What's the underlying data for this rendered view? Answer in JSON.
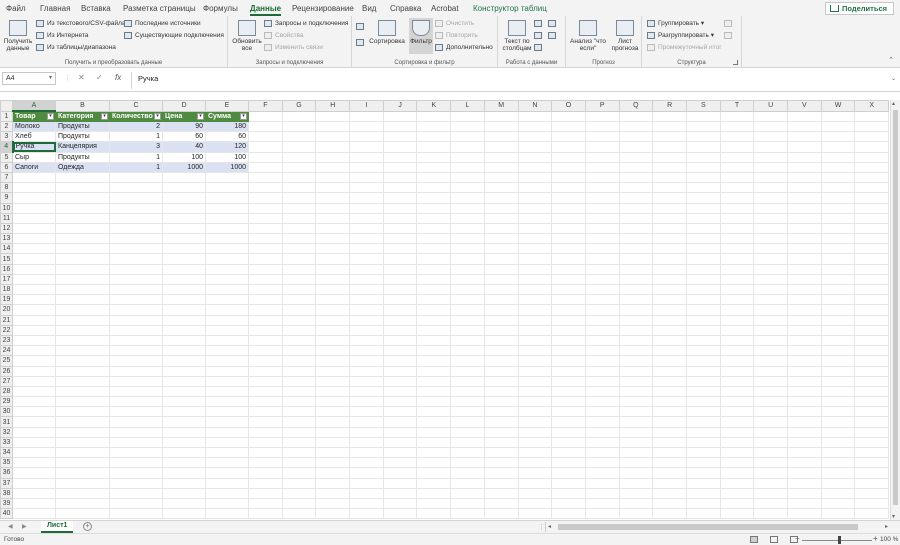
{
  "menu": {
    "tabs": [
      "Файл",
      "Главная",
      "Вставка",
      "Разметка страницы",
      "Формулы",
      "Данные",
      "Рецензирование",
      "Вид",
      "Справка",
      "Acrobat",
      "Конструктор таблиц"
    ],
    "active_tab": "Данные",
    "share_label": "Поделиться"
  },
  "ribbon": {
    "get_data": {
      "get_data_label": "Получить данные",
      "from_text_csv": "Из текстового/CSV-файла",
      "from_web": "Из Интернета",
      "from_table": "Из таблицы/диапазона",
      "recent_sources": "Последние источники",
      "existing_connections": "Существующие подключения",
      "group_label": "Получить и преобразовать данные"
    },
    "queries": {
      "refresh_all": "Обновить все",
      "queries_connections": "Запросы и подключения",
      "properties": "Свойства",
      "edit_links": "Изменить связи",
      "group_label": "Запросы и подключения"
    },
    "sort_filter": {
      "sort": "Сортировка",
      "filter": "Фильтр",
      "clear": "Очистить",
      "reapply": "Повторить",
      "advanced": "Дополнительно",
      "group_label": "Сортировка и фильтр"
    },
    "data_tools": {
      "text_to_columns": "Текст по столбцам",
      "group_label": "Работа с данными"
    },
    "forecast": {
      "what_if": "Анализ \"что если\"",
      "forecast_sheet": "Лист прогноза",
      "group_label": "Прогноз"
    },
    "outline": {
      "group": "Группировать",
      "ungroup": "Разгруппировать",
      "subtotal": "Промежуточный итог",
      "group_label": "Структура"
    }
  },
  "formula_bar": {
    "name_box": "A4",
    "fx": "fx",
    "content": "Ручка"
  },
  "grid": {
    "columns": [
      "A",
      "B",
      "C",
      "D",
      "E",
      "F",
      "G",
      "H",
      "I",
      "J",
      "K",
      "L",
      "M",
      "N",
      "O",
      "P",
      "Q",
      "R",
      "S",
      "T",
      "U",
      "V",
      "W",
      "X"
    ],
    "row_count": 40,
    "table_headers": [
      "Товар",
      "Категория",
      "Количество",
      "Цена",
      "Сумма"
    ],
    "table_rows": [
      [
        "Молоко",
        "Продукты",
        "2",
        "90",
        "180"
      ],
      [
        "Хлеб",
        "Продукты",
        "1",
        "60",
        "60"
      ],
      [
        "Ручка",
        "Канцелярия",
        "3",
        "40",
        "120"
      ],
      [
        "Сыр",
        "Продукты",
        "1",
        "100",
        "100"
      ],
      [
        "Сапоги",
        "Одежда",
        "1",
        "1000",
        "1000"
      ]
    ],
    "header_color": "#4e8a3f",
    "band_color": "#d9e1f2",
    "active_cell": "A4"
  },
  "sheets": {
    "tabs": [
      "Лист1"
    ],
    "active": "Лист1"
  },
  "status": {
    "ready": "Готово",
    "zoom": "100 %"
  }
}
